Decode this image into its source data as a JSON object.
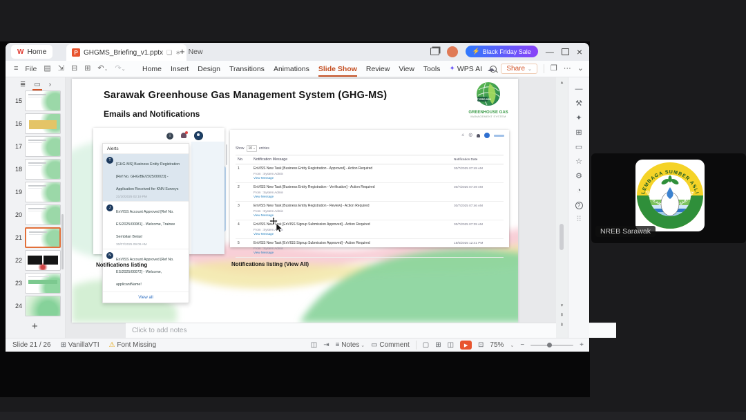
{
  "colors": {
    "accent_orange": "#d3552a",
    "promo_gradient_from": "#2f79fd",
    "promo_gradient_to": "#8a41f8",
    "link_blue": "#2e6fc2",
    "logo_green": "#3e9c4a"
  },
  "titlebar": {
    "home_label": "Home",
    "doc_title": "GHGMS_Briefing_v1.pptx",
    "new_label": "New",
    "promo_label": "Black Friday Sale"
  },
  "toolbar": {
    "file_label": "File",
    "menu_items": [
      "Home",
      "Insert",
      "Design",
      "Transitions",
      "Animations",
      "Slide Show",
      "Review",
      "View",
      "Tools",
      "WPS AI"
    ],
    "active_menu": "Slide Show",
    "share_label": "Share"
  },
  "thumb_panel": {
    "slides": [
      {
        "num": "15"
      },
      {
        "num": "16"
      },
      {
        "num": "17"
      },
      {
        "num": "18"
      },
      {
        "num": "19"
      },
      {
        "num": "20"
      },
      {
        "num": "21"
      },
      {
        "num": "22"
      },
      {
        "num": "23"
      },
      {
        "num": "24"
      }
    ],
    "selected": "21"
  },
  "slide": {
    "title": "Sarawak Greenhouse Gas Management System (GHG-MS)",
    "subtitle": "Emails and Notifications",
    "logo": {
      "badge": "NET ZERO 2050",
      "line1": "GREENHOUSE GAS",
      "line2": "MANAGEMENT SYSTEM"
    },
    "caption_left": "Notifications listing",
    "caption_right": "Notifications listing (View All)",
    "alerts": {
      "header": "Alerts",
      "view_all": "View all",
      "items": [
        {
          "initial": "T",
          "text": "[GHG-MS] Business Entity Registration [Ref No. GHG/BE/2025/00023] - Application Received for KNN Surveys",
          "time": "21/10/2025 02:19 PM"
        },
        {
          "initial": "J",
          "text": "EnVISS Account Approved [Ref No. ES/2025/00081] - Welcome, Trainee Sembilan Belas!",
          "time": "30/07/2025 09:09 AM"
        },
        {
          "initial": "N",
          "text": "EnVISS Account Approved [Ref No. ES/2025/00072] - Welcome, applicantName!",
          "time": ""
        }
      ]
    },
    "table": {
      "show_label": "Show",
      "show_value": "10",
      "entries_label": "entries",
      "col_no": "No.",
      "col_message": "Notification Message",
      "col_date": "Notification Date",
      "from_label": "From : System Admin",
      "link_label": "View Message",
      "rows": [
        {
          "no": "1",
          "message": "EnVISS New Task [Business Entity Registration - Approved] - Action Required",
          "date": "30/7/2025 07:49 AM"
        },
        {
          "no": "2",
          "message": "EnVISS New Task [Business Entity Registration - Verification] - Action Required",
          "date": "30/7/2025 07:49 AM"
        },
        {
          "no": "3",
          "message": "EnVISS New Task [Business Entity Registration - Review] - Action Required",
          "date": "30/7/2025 07:46 AM"
        },
        {
          "no": "4",
          "message": "EnVISS New Task [EnVISS Signup Submission Approved] - Action Required",
          "date": "30/7/2025 07:39 AM"
        },
        {
          "no": "5",
          "message": "EnVISS New Task [EnVISS Signup Submission Approved] - Action Required",
          "date": "18/6/2025 12:41 PM"
        }
      ]
    }
  },
  "notes": {
    "placeholder": "Click to add notes"
  },
  "statusbar": {
    "slide_counter": "Slide 21 / 26",
    "theme_name": "VanillaVTI",
    "font_warning": "Font Missing",
    "notes_label": "Notes",
    "comment_label": "Comment",
    "zoom_level": "75%"
  },
  "meeting": {
    "participant_label": "NREB Sarawak",
    "logo_top_arc": "LEMBAGA SUMBER ASLI",
    "logo_bottom_arc": "DAN ALAM SEKITAR SARAWAK"
  }
}
